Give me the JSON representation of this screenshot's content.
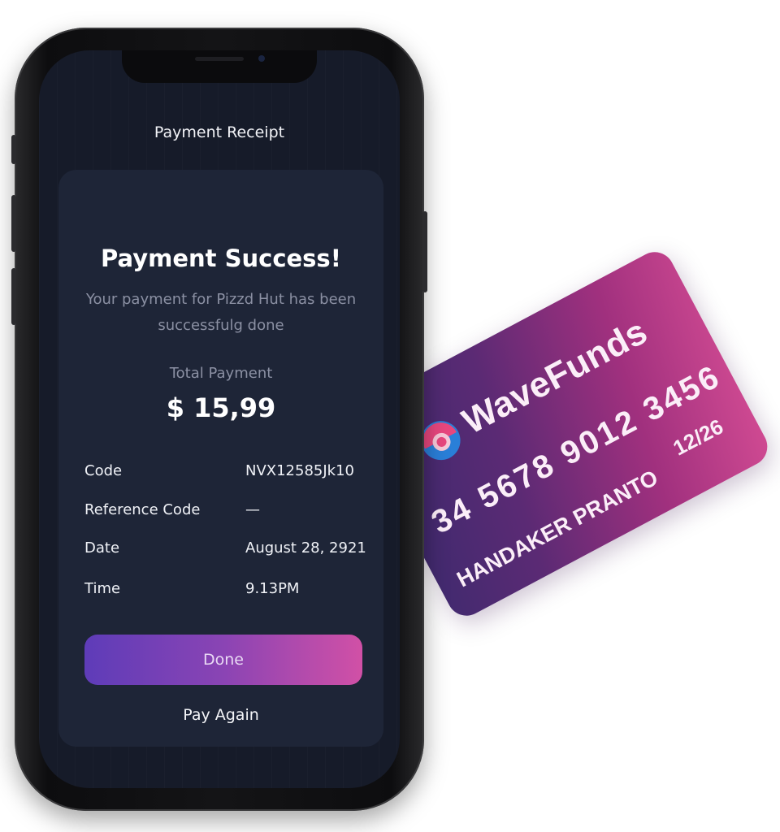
{
  "card": {
    "brand": "WaveFunds",
    "number": "34 5678 9012 3456",
    "expiry": "12/26",
    "holder": "HANDAKER PRANTO",
    "logo_icon": "wavefunds-logo-icon",
    "colors": {
      "gradient_start": "#3b2a6e",
      "gradient_end": "#d04a92"
    }
  },
  "screen": {
    "title": "Payment Receipt",
    "success_title": "Payment Success!",
    "success_message": "Your payment for Pizzd Hut has been successfulg done",
    "total_label": "Total Payment",
    "total_value": "$ 15,99",
    "details": [
      {
        "label": "Code",
        "value": "NVX12585Jk10"
      },
      {
        "label": "Reference Code",
        "value": "—"
      },
      {
        "label": "Date",
        "value": "August 28, 2921"
      },
      {
        "label": "Time",
        "value": "9.13PM"
      }
    ],
    "done_label": "Done",
    "pay_again_label": "Pay Again",
    "colors": {
      "background": "#161b29",
      "card": "#1e2537",
      "button_start": "#5e3cb8",
      "button_end": "#d150a6"
    }
  }
}
